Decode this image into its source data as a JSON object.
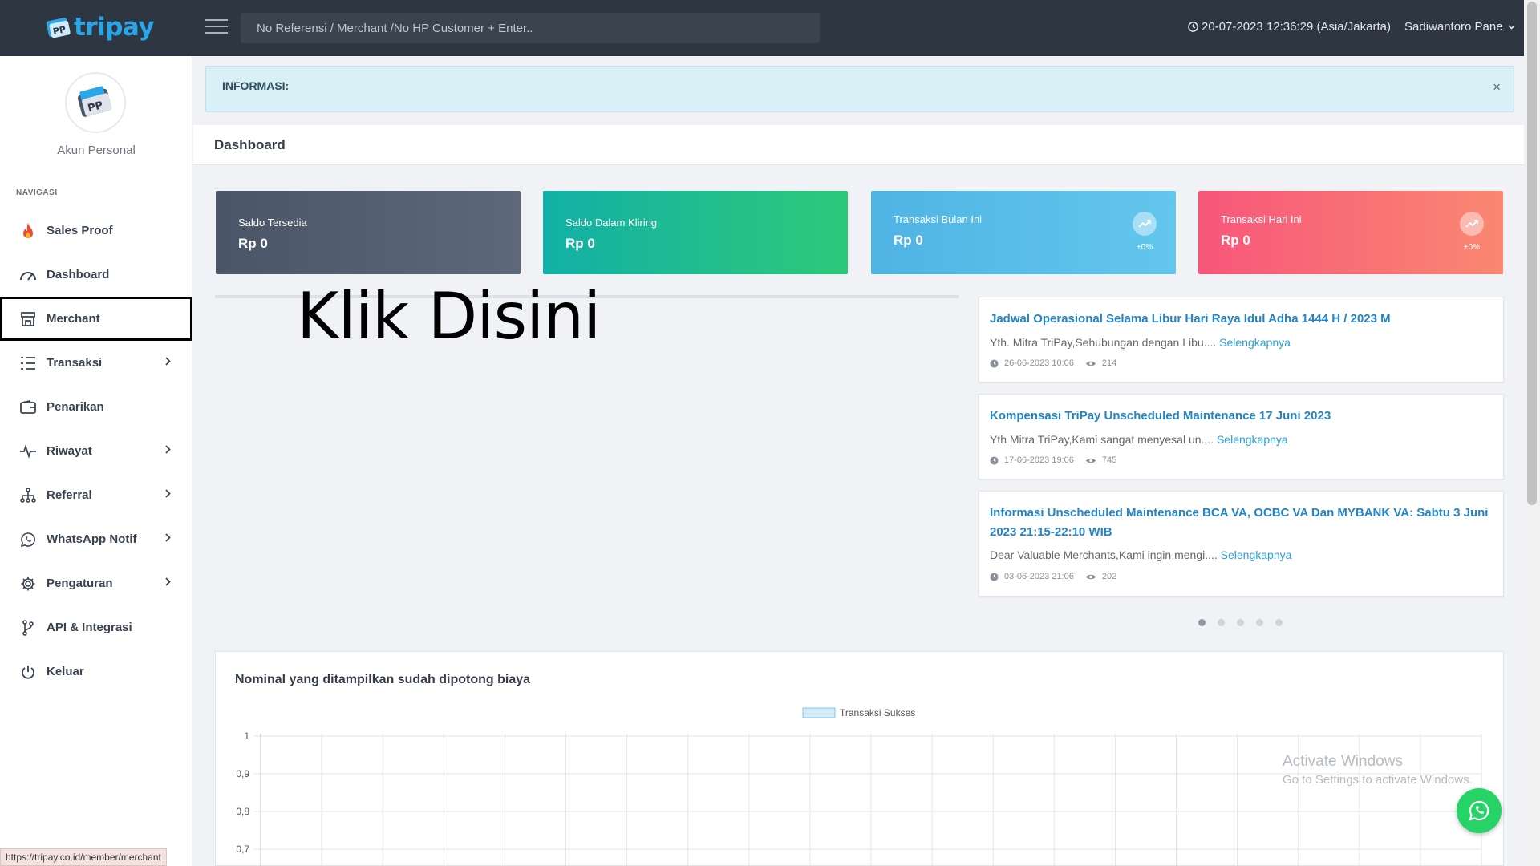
{
  "header": {
    "brand": "tripay",
    "search_placeholder": "No Referensi / Merchant /No HP Customer + Enter..",
    "datetime": "20-07-2023 12:36:29 (Asia/Jakarta)",
    "user_name": "Sadiwantoro Pane"
  },
  "sidebar": {
    "account_label": "Akun Personal",
    "nav_title": "NAVIGASI",
    "items": [
      {
        "label": "Sales Proof"
      },
      {
        "label": "Dashboard"
      },
      {
        "label": "Merchant"
      },
      {
        "label": "Transaksi"
      },
      {
        "label": "Penarikan"
      },
      {
        "label": "Riwayat"
      },
      {
        "label": "Referral"
      },
      {
        "label": "WhatsApp Notif"
      },
      {
        "label": "Pengaturan"
      },
      {
        "label": "API & Integrasi"
      },
      {
        "label": "Keluar"
      }
    ]
  },
  "alert": {
    "text": "INFORMASI:",
    "close": "×"
  },
  "page": {
    "title": "Dashboard"
  },
  "cards": [
    {
      "label": "Saldo Tersedia",
      "value": "Rp 0"
    },
    {
      "label": "Saldo Dalam Kliring",
      "value": "Rp 0"
    },
    {
      "label": "Transaksi Bulan Ini",
      "value": "Rp 0",
      "pct": "+0%"
    },
    {
      "label": "Transaksi Hari Ini",
      "value": "Rp 0",
      "pct": "+0%"
    }
  ],
  "annotation": "Klik Disini",
  "news": [
    {
      "title": "Jadwal Operasional Selama Libur Hari Raya Idul Adha 1444 H / 2023 M",
      "excerpt": "Yth. Mitra TriPay,Sehubungan dengan Libu.... ",
      "more": "Selengkapnya",
      "date": "26-06-2023 10:06",
      "views": "214"
    },
    {
      "title": "Kompensasi TriPay Unscheduled Maintenance 17 Juni 2023",
      "excerpt": "Yth Mitra TriPay,Kami sangat menyesal un.... ",
      "more": "Selengkapnya",
      "date": "17-06-2023 19:06",
      "views": "745"
    },
    {
      "title": "Informasi Unscheduled Maintenance BCA VA, OCBC VA Dan MYBANK VA: Sabtu 3 Juni 2023 21:15-22:10 WIB",
      "excerpt": "Dear Valuable Merchants,Kami ingin mengi.... ",
      "more": "Selengkapnya",
      "date": "03-06-2023 21:06",
      "views": "202"
    }
  ],
  "carousel": {
    "count": 5,
    "active_index": 0
  },
  "chart": {
    "title": "Nominal yang ditampilkan sudah dipotong biaya"
  },
  "chart_data": {
    "type": "bar",
    "series": [
      {
        "name": "Transaksi Sukses",
        "values": []
      }
    ],
    "y_ticks": [
      "1",
      "0,9",
      "0,8",
      "0,7"
    ],
    "ylim": [
      0,
      1
    ],
    "grid": true,
    "legend": "top-center",
    "colors": {
      "series_fill": "#d4ecfa",
      "series_stroke": "#7cc3ee"
    }
  },
  "watermark": {
    "line1": "Activate Windows",
    "line2": "Go to Settings to activate Windows."
  },
  "status_url": "https://tripay.co.id/member/merchant",
  "colors": {
    "topbar": "#2e3641",
    "brand": "#29a6e8",
    "link": "#2384c6",
    "whatsapp": "#25d366"
  }
}
